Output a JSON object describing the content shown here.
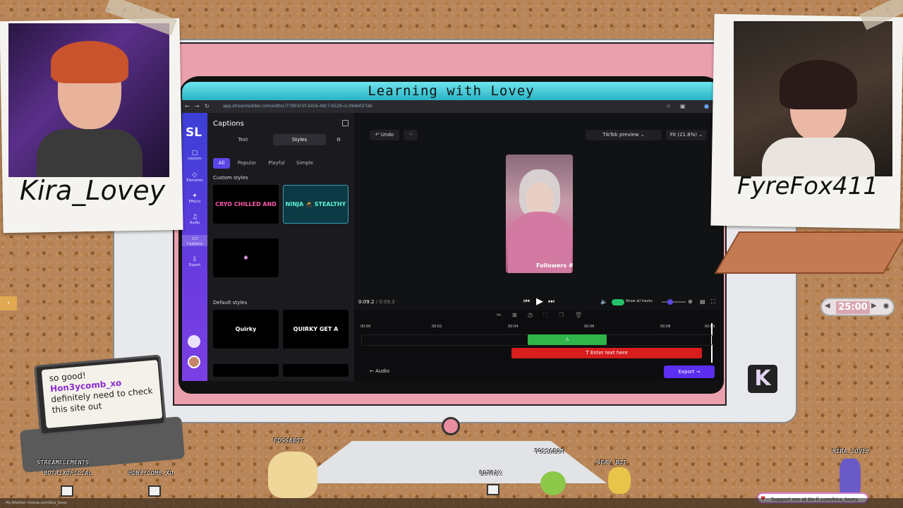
{
  "overlay": {
    "left_name": "Kira_Lovey",
    "right_name": "FyreFox411",
    "chat": {
      "message_part1": "so good!",
      "username": "Hon3ycomb_xo",
      "message_part2": "definitely need to check this site out"
    },
    "timer": "25:00",
    "kofi": "Support me at Ko-fi.com/kira_lovey",
    "kbadge": "K",
    "bottom_text": "My Wishlist: throne.com/kira_lovey",
    "bots": [
      "STREAMELEMENTS",
      "BOTRIXOFICIAL",
      "HON3YCOMB_XO",
      "FOSSABOT",
      "BOTRIX",
      "FOSSABOT",
      "SERY_BOT",
      "KIRA_LOVEY"
    ]
  },
  "window": {
    "title": "Learning with Lovey",
    "url": "app.streamladder.com/editor/77903c5f-2d16-49c7-b529-cc39de027eb"
  },
  "sidebar": {
    "logo": "SL",
    "items": [
      {
        "label": "Layouts",
        "icon": "▢"
      },
      {
        "label": "Elements",
        "icon": "◇"
      },
      {
        "label": "Effects",
        "icon": "✦"
      },
      {
        "label": "Audio",
        "icon": "♫"
      },
      {
        "label": "Captions",
        "icon": "▭"
      },
      {
        "label": "Export",
        "icon": "⇩"
      }
    ]
  },
  "panel": {
    "title": "Captions",
    "tabs": [
      "Text",
      "Styles"
    ],
    "filters": [
      "All",
      "Popular",
      "Playful",
      "Simple"
    ],
    "custom_label": "Custom styles",
    "custom_styles": [
      "CRYO CHILLED AND",
      "NINJA 🥷 STEALTHY",
      "✺"
    ],
    "default_label": "Default styles",
    "default_styles": [
      "Quirky",
      "QUIRKY GET A"
    ]
  },
  "stage": {
    "undo": "Undo",
    "preview": "TikTok preview",
    "fit": "Fit (21.8%)",
    "followers": "Followers #",
    "time_current": "0:09.2",
    "time_sep": "/",
    "time_total": "0:09.3",
    "show_tracks": "Show all tracks"
  },
  "timeline": {
    "ticks": [
      "00:00",
      "00:02",
      "00:04",
      "00:06",
      "00:08",
      "00:09"
    ],
    "text_track": "Enter text here",
    "audio": "Audio",
    "export": "Export"
  }
}
